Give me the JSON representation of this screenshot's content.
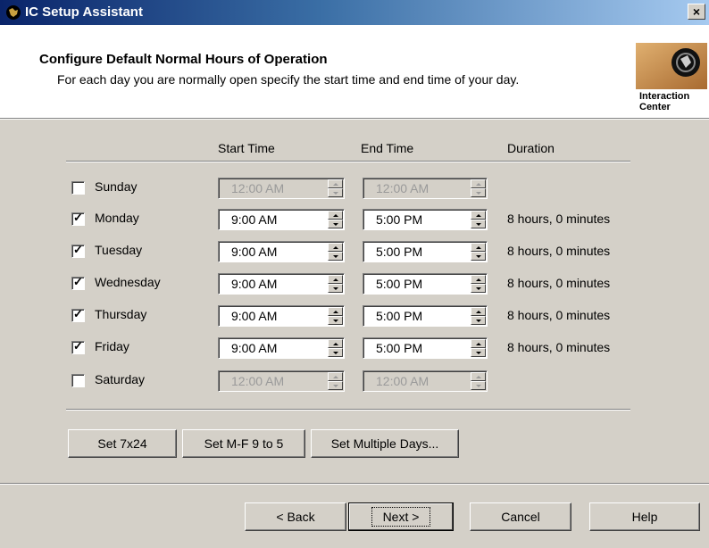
{
  "window": {
    "title": "IC Setup Assistant",
    "close_glyph": "×"
  },
  "header": {
    "title": "Configure Default Normal Hours of Operation",
    "subtitle": "For each day you are normally open specify the start time and end time of your day.",
    "logo_line1": "Interaction",
    "logo_line2": "Center"
  },
  "columns": {
    "start": "Start Time",
    "end": "End Time",
    "duration": "Duration"
  },
  "days": [
    {
      "label": "Sunday",
      "checked": false,
      "start": "12:00 AM",
      "end": "12:00 AM",
      "duration": ""
    },
    {
      "label": "Monday",
      "checked": true,
      "start": "9:00 AM",
      "end": "5:00 PM",
      "duration": "8 hours, 0 minutes"
    },
    {
      "label": "Tuesday",
      "checked": true,
      "start": "9:00 AM",
      "end": "5:00 PM",
      "duration": "8 hours, 0 minutes"
    },
    {
      "label": "Wednesday",
      "checked": true,
      "start": "9:00 AM",
      "end": "5:00 PM",
      "duration": "8 hours, 0 minutes"
    },
    {
      "label": "Thursday",
      "checked": true,
      "start": "9:00 AM",
      "end": "5:00 PM",
      "duration": "8 hours, 0 minutes"
    },
    {
      "label": "Friday",
      "checked": true,
      "start": "9:00 AM",
      "end": "5:00 PM",
      "duration": "8 hours, 0 minutes"
    },
    {
      "label": "Saturday",
      "checked": false,
      "start": "12:00 AM",
      "end": "12:00 AM",
      "duration": ""
    }
  ],
  "presets": {
    "set_7x24": "Set 7x24",
    "set_mf": "Set M-F 9 to 5",
    "set_multiple": "Set Multiple Days..."
  },
  "footer": {
    "back": "< Back",
    "next": "Next >",
    "cancel": "Cancel",
    "help": "Help"
  },
  "colors": {
    "title_start": "#0a246a",
    "title_end": "#a6caf0",
    "face": "#d4d0c8"
  },
  "icons": {
    "title_icon": "ic-globe-icon",
    "logo": "interaction-center-logo",
    "spin": "spin-arrows-icon",
    "check": "checkmark-icon"
  }
}
